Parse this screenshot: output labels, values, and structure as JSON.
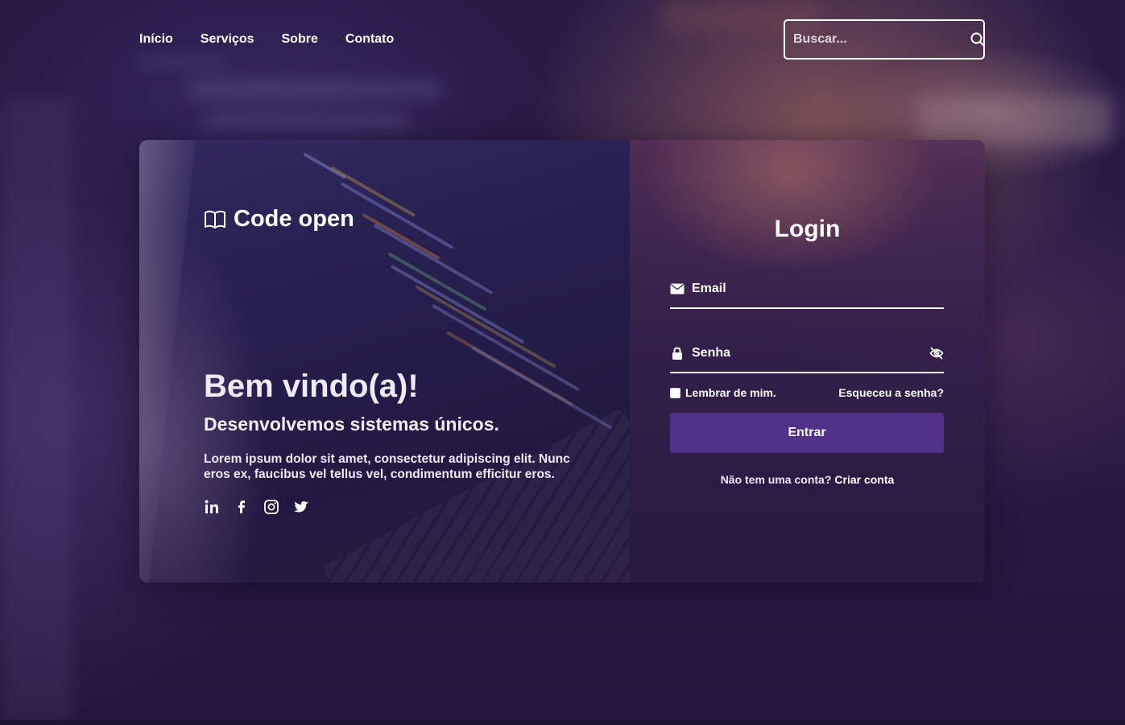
{
  "nav": {
    "items": [
      {
        "label": "Início"
      },
      {
        "label": "Serviços"
      },
      {
        "label": "Sobre"
      },
      {
        "label": "Contato"
      }
    ],
    "search_placeholder": "Buscar...",
    "search_icon": "search-icon"
  },
  "brand": {
    "icon": "open-book-icon",
    "title": "Code open"
  },
  "welcome": {
    "title": "Bem vindo(a)!",
    "subtitle": "Desenvolvemos sistemas únicos.",
    "text": "Lorem ipsum dolor sit amet, consectetur adipiscing elit. Nunc eros ex, faucibus vel tellus vel, condimentum efficitur eros."
  },
  "social": [
    "linkedin-icon",
    "facebook-icon",
    "instagram-icon",
    "twitter-icon"
  ],
  "login": {
    "title": "Login",
    "email_placeholder": "Email",
    "password_placeholder": "Senha",
    "remember_label": "Lembrar de mim.",
    "forgot_label": "Esqueceu a senha?",
    "submit_label": "Entrar",
    "no_account_text": "Não tem uma conta?",
    "create_account_label": "Criar conta"
  },
  "colors": {
    "accent": "#52308a",
    "background": "#2a1d48"
  }
}
